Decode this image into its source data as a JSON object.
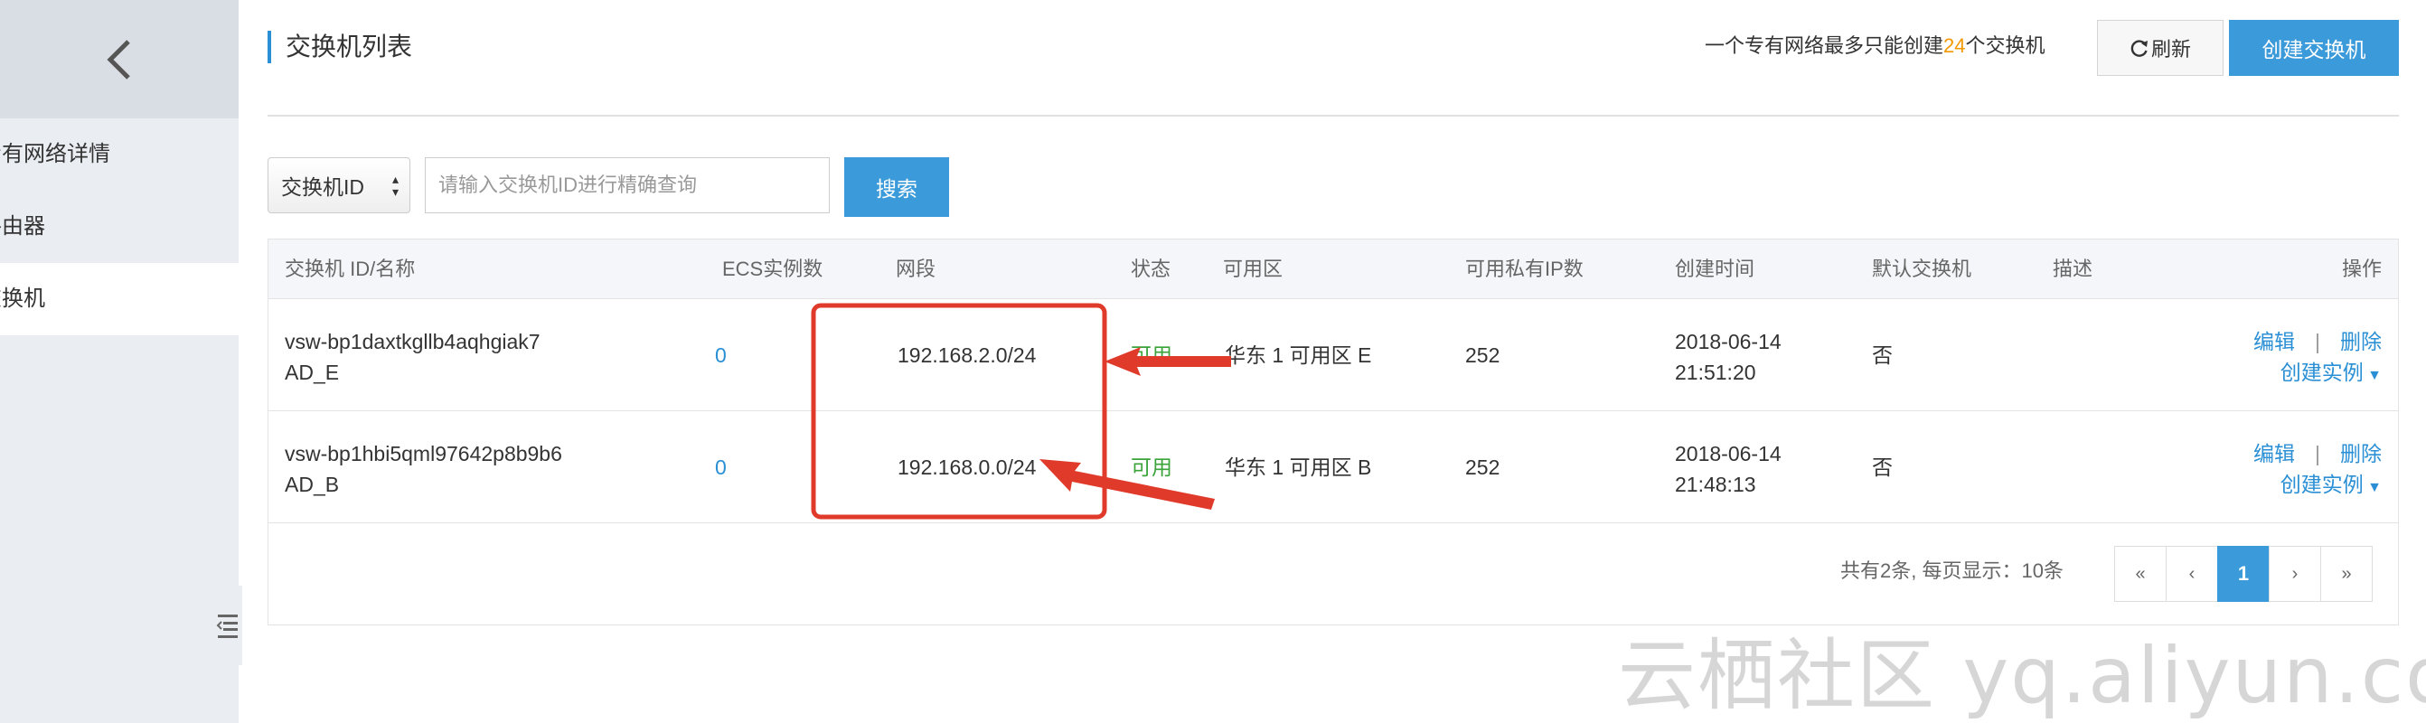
{
  "sidebar": {
    "items": [
      {
        "label": "专有网络详情"
      },
      {
        "label": "路由器"
      },
      {
        "label": "交换机"
      }
    ]
  },
  "header": {
    "title": "交换机列表",
    "limit_prefix": "一个专有网络最多只能创建",
    "limit_number": "24",
    "limit_suffix": "个交换机",
    "refresh_label": "刷新",
    "create_label": "创建交换机"
  },
  "search": {
    "select_value": "交换机ID",
    "placeholder": "请输入交换机ID进行精确查询",
    "button_label": "搜索"
  },
  "table": {
    "columns": [
      "交换机 ID/名称",
      "ECS实例数",
      "网段",
      "状态",
      "可用区",
      "可用私有IP数",
      "创建时间",
      "默认交换机",
      "描述",
      "操作"
    ],
    "rows": [
      {
        "id": "vsw-bp1daxtkgllb4aqhgiak7",
        "name": "AD_E",
        "ecs": "0",
        "cidr": "192.168.2.0/24",
        "status": "可用",
        "zone": "华东 1 可用区 E",
        "ips": "252",
        "date": "2018-06-14",
        "time": "21:51:20",
        "default": "否",
        "desc": "",
        "edit": "编辑",
        "delete": "删除",
        "create_instance": "创建实例"
      },
      {
        "id": "vsw-bp1hbi5qml97642p8b9b6",
        "name": "AD_B",
        "ecs": "0",
        "cidr": "192.168.0.0/24",
        "status": "可用",
        "zone": "华东 1 可用区 B",
        "ips": "252",
        "date": "2018-06-14",
        "time": "21:48:13",
        "default": "否",
        "desc": "",
        "edit": "编辑",
        "delete": "删除",
        "create_instance": "创建实例"
      }
    ]
  },
  "pagination": {
    "summary": "共有2条, 每页显示：10条",
    "first": "«",
    "prev": "‹",
    "current": "1",
    "next": "›",
    "last": "»"
  },
  "watermark": "云栖社区 yq.aliyun.com",
  "colors": {
    "accent": "#3b9ad9",
    "link": "#2a8fd4",
    "status_ok": "#3aa33a",
    "highlight": "#f39800",
    "annotation": "#e03a2a"
  },
  "icons": [
    "chevron-left-icon",
    "refresh-icon",
    "sort-arrows-icon",
    "caret-down-icon",
    "menu-toggle-icon"
  ]
}
